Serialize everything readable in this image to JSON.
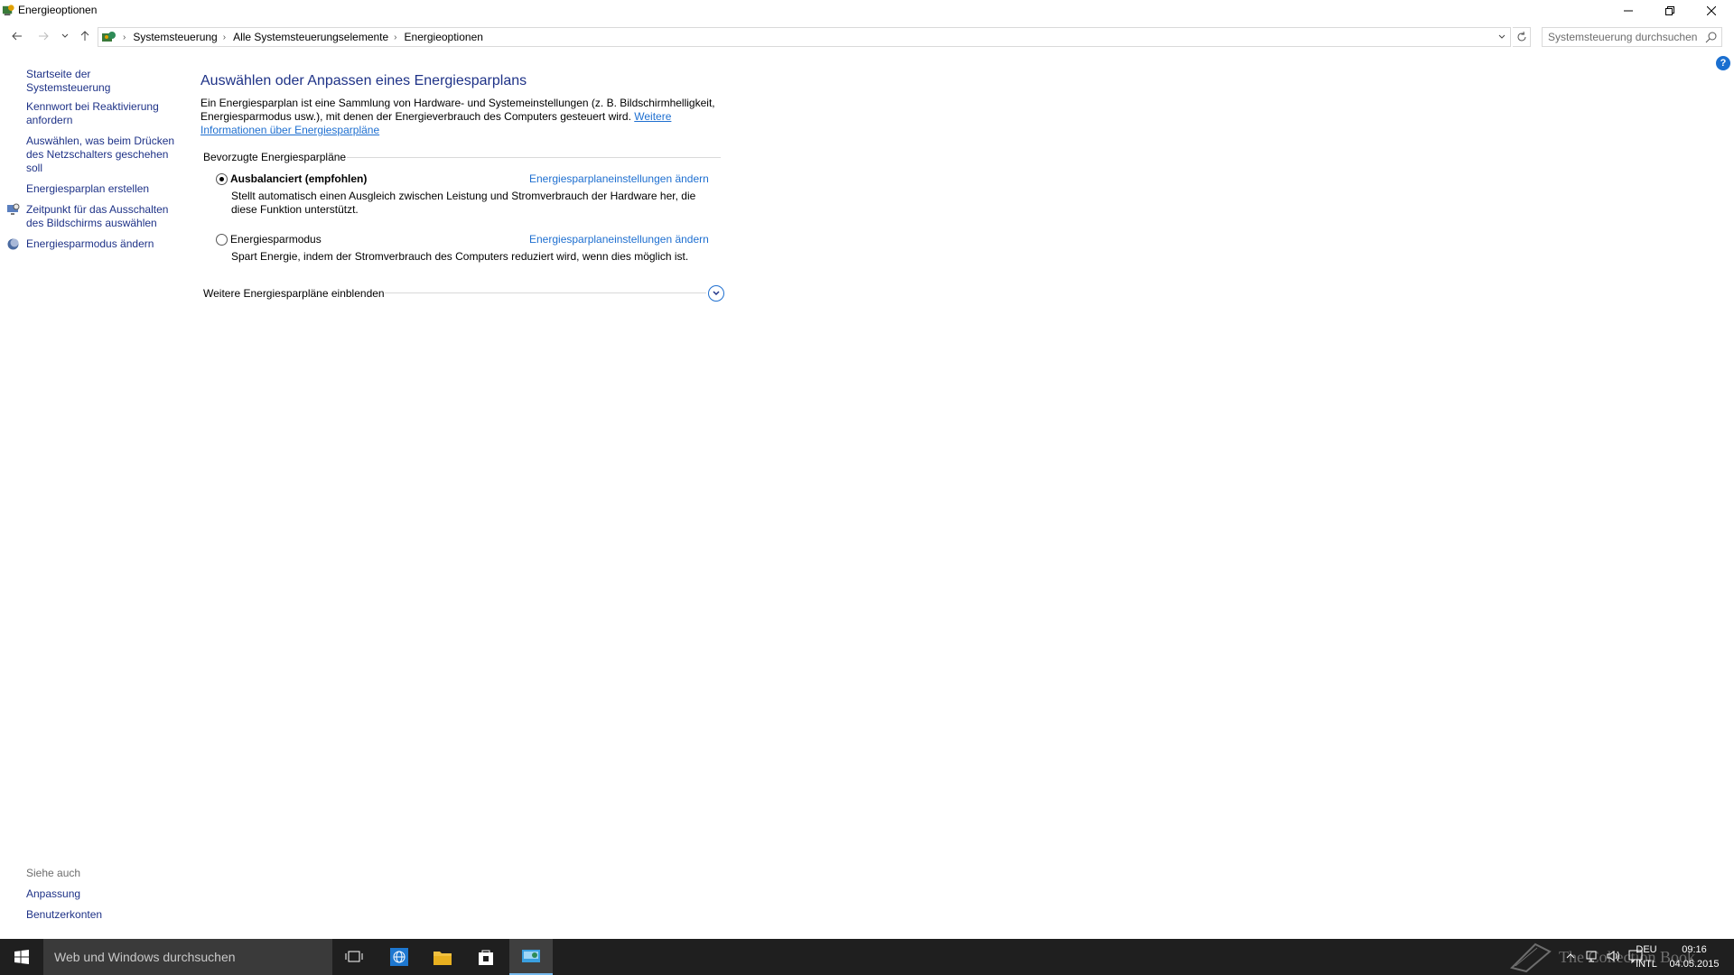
{
  "window": {
    "title": "Energieoptionen"
  },
  "nav": {
    "back_icon": "back-arrow-icon",
    "forward_icon": "forward-arrow-icon",
    "recent_icon": "chevron-down-icon",
    "up_icon": "up-arrow-icon",
    "breadcrumbs": [
      "Systemsteuerung",
      "Alle Systemsteuerungselemente",
      "Energieoptionen"
    ],
    "search_placeholder": "Systemsteuerung durchsuchen"
  },
  "sidebar": {
    "items": [
      {
        "label": "Startseite der Systemsteuerung"
      },
      {
        "label": "Kennwort bei Reaktivierung anfordern"
      },
      {
        "label": "Auswählen, was beim Drücken des Netzschalters geschehen soll"
      },
      {
        "label": "Energiesparplan erstellen"
      },
      {
        "label": "Zeitpunkt für das Ausschalten des Bildschirms auswählen"
      },
      {
        "label": "Energiesparmodus ändern"
      }
    ],
    "see_also": {
      "title": "Siehe auch",
      "links": [
        "Anpassung",
        "Benutzerkonten"
      ]
    }
  },
  "main": {
    "title": "Auswählen oder Anpassen eines Energiesparplans",
    "intro_text": "Ein Energiesparplan ist eine Sammlung von Hardware- und Systemeinstellungen (z. B. Bildschirmhelligkeit, Energiesparmodus usw.), mit denen der Energieverbrauch des Computers gesteuert wird. ",
    "intro_link": "Weitere Informationen über Energiesparpläne",
    "section_title": "Bevorzugte Energiesparpläne",
    "plans": [
      {
        "name": "Ausbalanciert (empfohlen)",
        "selected": true,
        "link": "Energiesparplaneinstellungen ändern",
        "description": "Stellt automatisch einen Ausgleich zwischen Leistung und Stromverbrauch der Hardware her, die diese Funktion unterstützt."
      },
      {
        "name": "Energiesparmodus",
        "selected": false,
        "link": "Energiesparplaneinstellungen ändern",
        "description": "Spart Energie, indem der Stromverbrauch des Computers reduziert wird, wenn dies möglich ist."
      }
    ],
    "more_plans_label": "Weitere Energiesparpläne einblenden"
  },
  "taskbar": {
    "search_placeholder": "Web und Windows durchsuchen",
    "language": "DEU",
    "keyboard": "INTL",
    "time": "09:16",
    "date": "04.05.2015",
    "watermark": "The Collection Book"
  },
  "colors": {
    "link": "#1e3287",
    "accent_link": "#1e6fd0",
    "taskbar": "#1f1f1f"
  }
}
